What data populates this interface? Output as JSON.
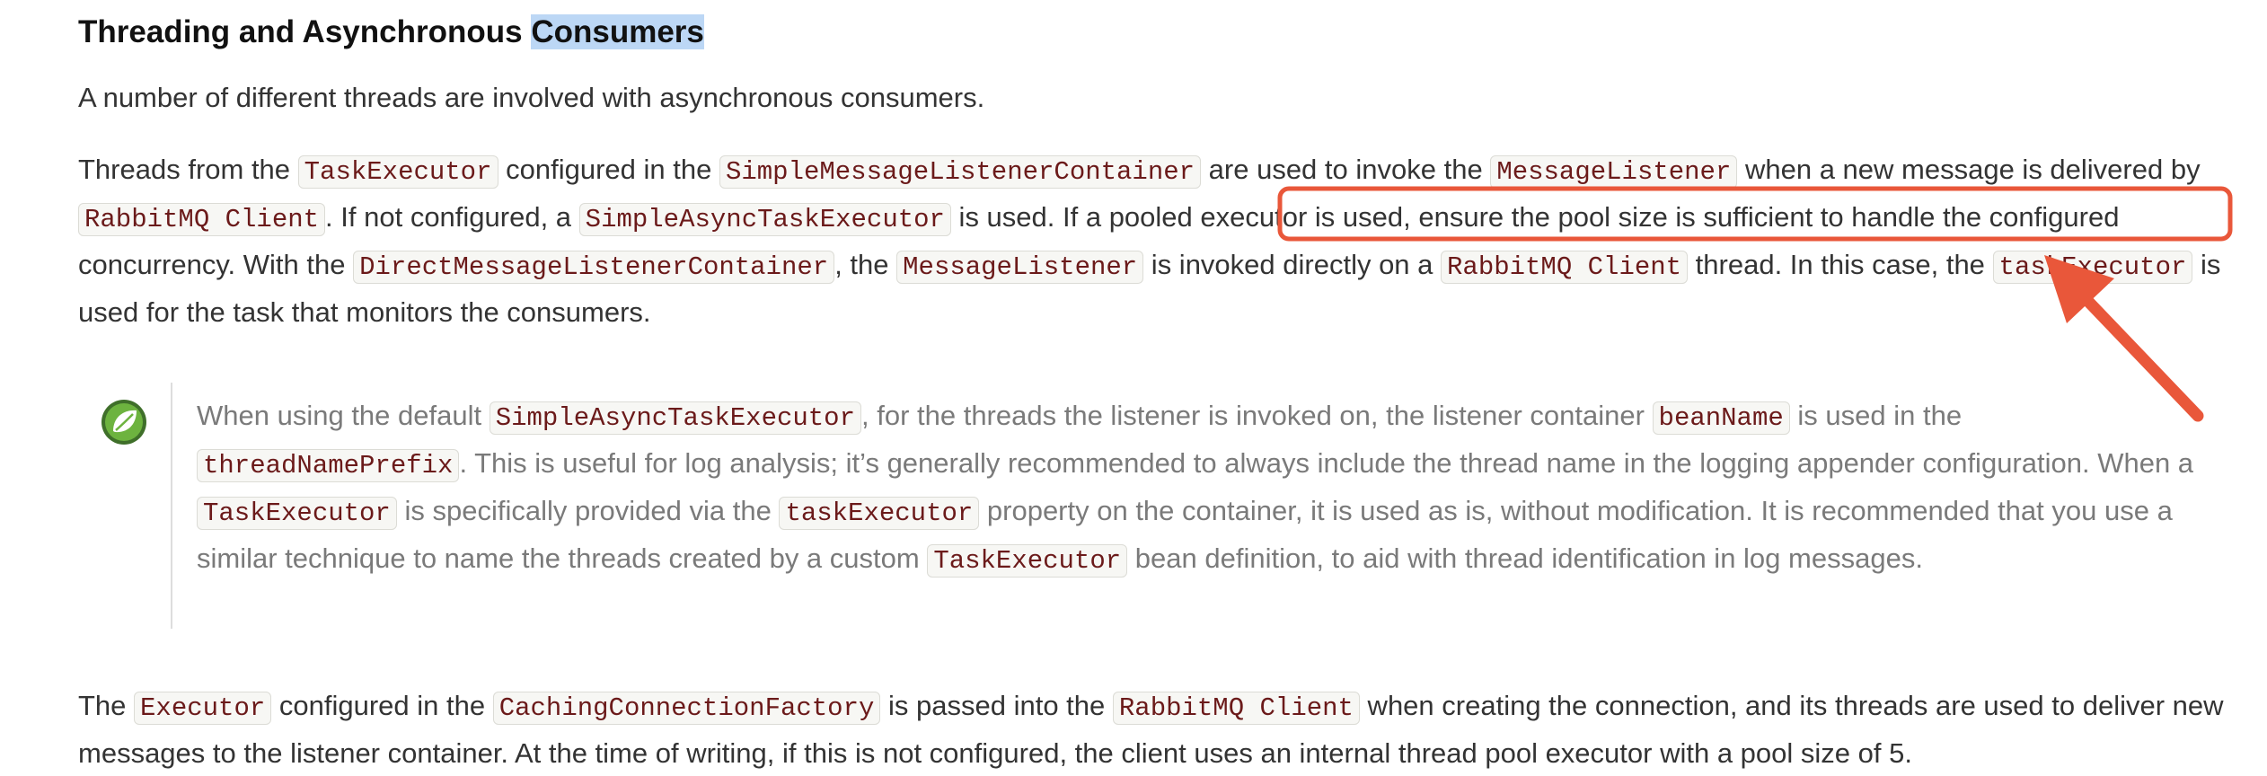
{
  "heading": {
    "before": "Threading and Asynchronous ",
    "highlighted": "Consumers"
  },
  "intro": "A number of different threads are involved with asynchronous consumers.",
  "para1": {
    "t1": "Threads from the ",
    "c1": "TaskExecutor",
    "t2": " configured in the ",
    "c2": "SimpleMessageListenerContainer",
    "t3": " are used to invoke the ",
    "c3": "MessageListener",
    "t4": " when a new message is delivered by ",
    "c4": "RabbitMQ Client",
    "t5": ". If not configured, a ",
    "c5": "SimpleAsyncTaskExecutor",
    "t6": " is used. If a pooled executor is used, ensure the pool size is sufficient to handle the configured concurrency. With the ",
    "c6": "DirectMessageListenerContainer",
    "t7": ", the ",
    "c7": "MessageListener",
    "t8": " is invoked directly on a ",
    "c8": "RabbitMQ Client",
    "t9": " thread. In this case, the ",
    "c9": "taskExecutor",
    "t10": " is used for the task that monitors the consumers."
  },
  "note": {
    "icon": "spring-leaf-icon",
    "t1": "When using the default ",
    "c1": "SimpleAsyncTaskExecutor",
    "t2": ", for the threads the listener is invoked on, the listener container ",
    "c2": "beanName",
    "t3": " is used in the ",
    "c3": "threadNamePrefix",
    "t4": ". This is useful for log analysis; it’s generally recommended to always include the thread name in the logging appender configuration. When a ",
    "c4": "TaskExecutor",
    "t5": " is specifically provided via the ",
    "c5": "taskExecutor",
    "t6": " property on the container, it is used as is, without modification. It is recommended that you use a similar technique to name the threads created by a custom ",
    "c6": "TaskExecutor",
    "t7": " bean definition, to aid with thread identification in log messages."
  },
  "para3": {
    "t1": "The ",
    "c1": "Executor",
    "t2": " configured in the ",
    "c2": "CachingConnectionFactory",
    "t3": " is passed into the ",
    "c3": "RabbitMQ Client",
    "t4": " when creating the connection, and its threads are used to deliver new messages to the listener container. At the time of writing, if this is not configured, the client uses an internal thread pool executor with a pool size of 5."
  },
  "colors": {
    "annotation": "#e9573a",
    "code_text": "#6b1a1a",
    "highlight": "#bcd7f5",
    "spring_green": "#6db33f"
  }
}
